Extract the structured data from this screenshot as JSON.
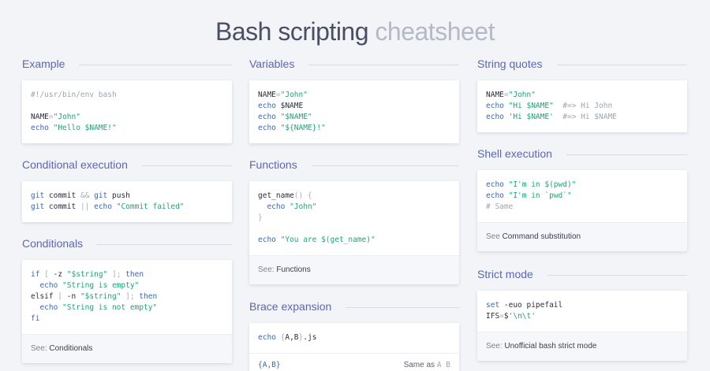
{
  "title": {
    "main": "Bash scripting",
    "muted": "cheatsheet"
  },
  "colors": {
    "accent": "#5a67b8",
    "string": "#26a07a",
    "keyword": "#3a66b8",
    "comment": "#9ea4b3",
    "background": "#f3f4f8"
  },
  "columns": [
    {
      "sections": [
        {
          "title": "Example",
          "code": [
            [
              {
                "t": "#!/usr/bin/env bash",
                "k": "comment"
              }
            ],
            [],
            [
              {
                "t": "NAME",
                "k": "plain"
              },
              {
                "t": "=",
                "k": "op"
              },
              {
                "t": "\"John\"",
                "k": "str"
              }
            ],
            [
              {
                "t": "echo ",
                "k": "kw"
              },
              {
                "t": "\"Hello $NAME!\"",
                "k": "str"
              }
            ]
          ]
        },
        {
          "title": "Conditional execution",
          "code": [
            [
              {
                "t": "git",
                "k": "kw"
              },
              {
                "t": " commit ",
                "k": "plain"
              },
              {
                "t": "&&",
                "k": "op"
              },
              {
                "t": " git",
                "k": "kw"
              },
              {
                "t": " push",
                "k": "plain"
              }
            ],
            [
              {
                "t": "git",
                "k": "kw"
              },
              {
                "t": " commit ",
                "k": "plain"
              },
              {
                "t": "||",
                "k": "op"
              },
              {
                "t": " echo ",
                "k": "kw"
              },
              {
                "t": "\"Commit failed\"",
                "k": "str"
              }
            ]
          ]
        },
        {
          "title": "Conditionals",
          "code": [
            [
              {
                "t": "if",
                "k": "kw"
              },
              {
                "t": " [ ",
                "k": "op"
              },
              {
                "t": "-z ",
                "k": "plain"
              },
              {
                "t": "\"$string\"",
                "k": "str"
              },
              {
                "t": " ];",
                "k": "op"
              },
              {
                "t": " then",
                "k": "kw"
              }
            ],
            [
              {
                "t": "  echo ",
                "k": "kw"
              },
              {
                "t": "\"String is empty\"",
                "k": "str"
              }
            ],
            [
              {
                "t": "elsif",
                "k": "plain"
              },
              {
                "t": " [ ",
                "k": "op"
              },
              {
                "t": "-n ",
                "k": "plain"
              },
              {
                "t": "\"$string\"",
                "k": "str"
              },
              {
                "t": " ];",
                "k": "op"
              },
              {
                "t": " then",
                "k": "kw"
              }
            ],
            [
              {
                "t": "  echo ",
                "k": "kw"
              },
              {
                "t": "\"String is not empty\"",
                "k": "str"
              }
            ],
            [
              {
                "t": "fi",
                "k": "kw"
              }
            ]
          ],
          "footer": {
            "prefix": "See: ",
            "link": "Conditionals"
          }
        }
      ]
    },
    {
      "sections": [
        {
          "title": "Variables",
          "code": [
            [
              {
                "t": "NAME",
                "k": "plain"
              },
              {
                "t": "=",
                "k": "op"
              },
              {
                "t": "\"John\"",
                "k": "str"
              }
            ],
            [
              {
                "t": "echo",
                "k": "kw"
              },
              {
                "t": " $NAME",
                "k": "plain"
              }
            ],
            [
              {
                "t": "echo ",
                "k": "kw"
              },
              {
                "t": "\"$NAME\"",
                "k": "str"
              }
            ],
            [
              {
                "t": "echo ",
                "k": "kw"
              },
              {
                "t": "\"${NAME}!\"",
                "k": "str"
              }
            ]
          ]
        },
        {
          "title": "Functions",
          "code": [
            [
              {
                "t": "get_name",
                "k": "plain"
              },
              {
                "t": "() {",
                "k": "op"
              }
            ],
            [
              {
                "t": "  echo ",
                "k": "kw"
              },
              {
                "t": "\"John\"",
                "k": "str"
              }
            ],
            [
              {
                "t": "}",
                "k": "op"
              }
            ],
            [],
            [
              {
                "t": "echo ",
                "k": "kw"
              },
              {
                "t": "\"You are $(get_name)\"",
                "k": "str"
              }
            ]
          ],
          "footer": {
            "prefix": "See: ",
            "link": "Functions"
          }
        },
        {
          "title": "Brace expansion",
          "code": [
            [
              {
                "t": "echo",
                "k": "kw"
              },
              {
                "t": " {",
                "k": "op"
              },
              {
                "t": "A,B",
                "k": "plain"
              },
              {
                "t": "}",
                "k": "op"
              },
              {
                "t": ".js",
                "k": "plain"
              }
            ]
          ],
          "split_row": {
            "left": "{A,B}",
            "desc": "Same as",
            "desc_code": "A B"
          }
        }
      ]
    },
    {
      "sections": [
        {
          "title": "String quotes",
          "code": [
            [
              {
                "t": "NAME",
                "k": "plain"
              },
              {
                "t": "=",
                "k": "op"
              },
              {
                "t": "\"John\"",
                "k": "str"
              }
            ],
            [
              {
                "t": "echo ",
                "k": "kw"
              },
              {
                "t": "\"Hi $NAME\"",
                "k": "str"
              },
              {
                "t": "  #=> Hi John",
                "k": "comment"
              }
            ],
            [
              {
                "t": "echo ",
                "k": "kw"
              },
              {
                "t": "'Hi $NAME'",
                "k": "str"
              },
              {
                "t": "  #=> Hi $NAME",
                "k": "comment"
              }
            ]
          ]
        },
        {
          "title": "Shell execution",
          "code": [
            [
              {
                "t": "echo ",
                "k": "kw"
              },
              {
                "t": "\"I'm in $(pwd)\"",
                "k": "str"
              }
            ],
            [
              {
                "t": "echo ",
                "k": "kw"
              },
              {
                "t": "\"I'm in `pwd`\"",
                "k": "str"
              }
            ],
            [
              {
                "t": "# Same",
                "k": "comment"
              }
            ]
          ],
          "footer": {
            "prefix": "See ",
            "link": "Command substitution"
          }
        },
        {
          "title": "Strict mode",
          "code": [
            [
              {
                "t": "set",
                "k": "kw"
              },
              {
                "t": " -euo pipefail",
                "k": "plain"
              }
            ],
            [
              {
                "t": "IFS",
                "k": "plain"
              },
              {
                "t": "=",
                "k": "op"
              },
              {
                "t": "$",
                "k": "plain"
              },
              {
                "t": "'\\n\\t'",
                "k": "str"
              }
            ]
          ],
          "footer": {
            "prefix": "See: ",
            "link": "Unofficial bash strict mode"
          }
        }
      ]
    }
  ]
}
